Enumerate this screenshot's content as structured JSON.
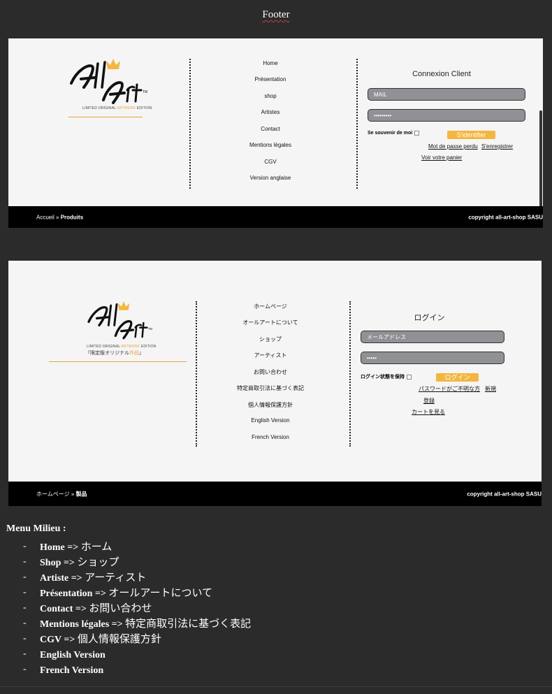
{
  "page_title": "Footer",
  "logo": {
    "brand": "All Art",
    "tagline_start": "LIMITED ORIGINAL ",
    "tagline_mid": "ARTWORK",
    "tagline_end": " EDITION",
    "jp_tagline_start": "『限定版オリジナル",
    "jp_tagline_mid": "作品",
    "jp_tagline_end": "』"
  },
  "fr_footer": {
    "menu": [
      "Home",
      "Présentation",
      "shop",
      "Artistes",
      "Contact",
      "Mentions légales",
      "CGV",
      "Version anglaise"
    ],
    "login": {
      "title": "Connexion Client",
      "email_placeholder": "MAIL",
      "password_value": "•••••••••",
      "remember": "Se souvenir de moi",
      "submit": "S'identifier",
      "forgot": "Mot de passe perdu",
      "register": "S'enregistrer",
      "cart": "Voir votre panier"
    },
    "breadcrumb_home": "Accueil",
    "breadcrumb_sep": " » ",
    "breadcrumb_current": "Produits",
    "copyright": "copyright all-art-shop SASU"
  },
  "jp_footer": {
    "menu": [
      "ホームページ",
      "オールアートについて",
      "ショップ",
      "アーティスト",
      "お問い合わせ",
      "特定商取引法に基づく表記",
      "個人情報保護方針",
      "English Version",
      "French Version"
    ],
    "login": {
      "title": "ログイン",
      "email_placeholder": "メールアドレス",
      "password_value": "•••••",
      "remember": "ログイン状態を保持",
      "submit": "ログイン",
      "forgot": "パスワードがご不明な方",
      "new": "新規",
      "register": "登録",
      "cart": "カートを見る"
    },
    "breadcrumb_home": "ホームページ",
    "breadcrumb_sep": " » ",
    "breadcrumb_current": "製品",
    "copyright": "copyright all-art-shop SASU"
  },
  "notes": {
    "title": "Menu Milieu :",
    "dash": "-",
    "items": [
      {
        "en": "Home => ",
        "jp": "ホーム"
      },
      {
        "en": "Shop => ",
        "jp": "ショップ"
      },
      {
        "en": "Artiste => ",
        "jp": "アーティスト"
      },
      {
        "en": "Présentation => ",
        "jp": "オールアートについて"
      },
      {
        "en": "Contact => ",
        "jp": "お問い合わせ"
      },
      {
        "en": "Mentions légales => ",
        "jp": "特定商取引法に基づく表記"
      },
      {
        "en": "CGV => ",
        "jp": "個人情報保護方針"
      },
      {
        "en": "English Version",
        "jp": ""
      },
      {
        "en": "French Version",
        "jp": ""
      }
    ]
  },
  "colors": {
    "accent": "#f3b640",
    "bar": "#000000",
    "panel": "#f5f5f5",
    "field": "#909194"
  },
  "icons": {
    "crown": "crown-icon",
    "checkbox": "checkbox"
  }
}
